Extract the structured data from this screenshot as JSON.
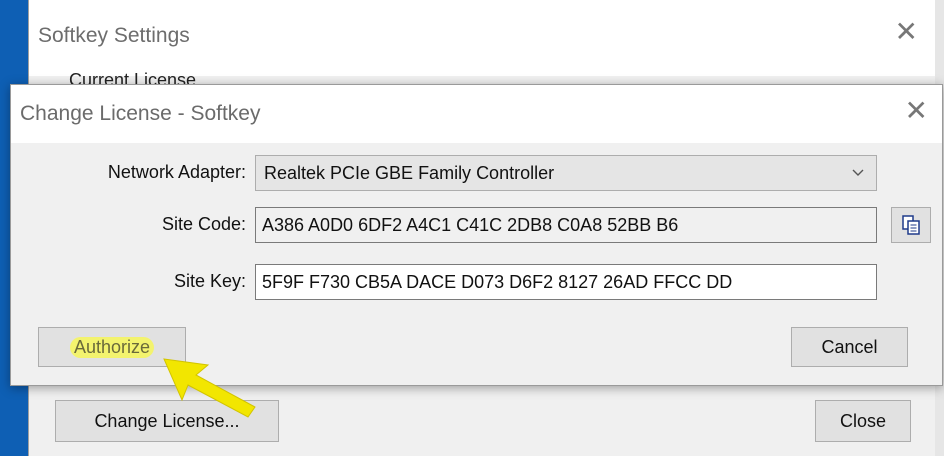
{
  "back_window": {
    "title": "Softkey Settings",
    "group_label": "Current License",
    "change_license_button": "Change License...",
    "close_button": "Close"
  },
  "dialog": {
    "title": "Change License - Softkey",
    "network_adapter": {
      "label": "Network Adapter:",
      "value": "Realtek PCIe GBE Family Controller"
    },
    "site_code": {
      "label": "Site Code:",
      "value": "A386 A0D0 6DF2 A4C1 C41C 2DB8 C0A8 52BB B6"
    },
    "site_key": {
      "label": "Site Key:",
      "value": "5F9F F730 CB5A DACE D073 D6F2 8127 26AD FFCC DD"
    },
    "authorize_button": "Authorize",
    "cancel_button": "Cancel"
  },
  "annotation": {
    "arrow_color": "#f2e600",
    "highlight_color": "#f3f36e"
  },
  "icons": [
    "close-icon",
    "chevron-down-icon",
    "copy-icon",
    "annotation-arrow-icon"
  ]
}
